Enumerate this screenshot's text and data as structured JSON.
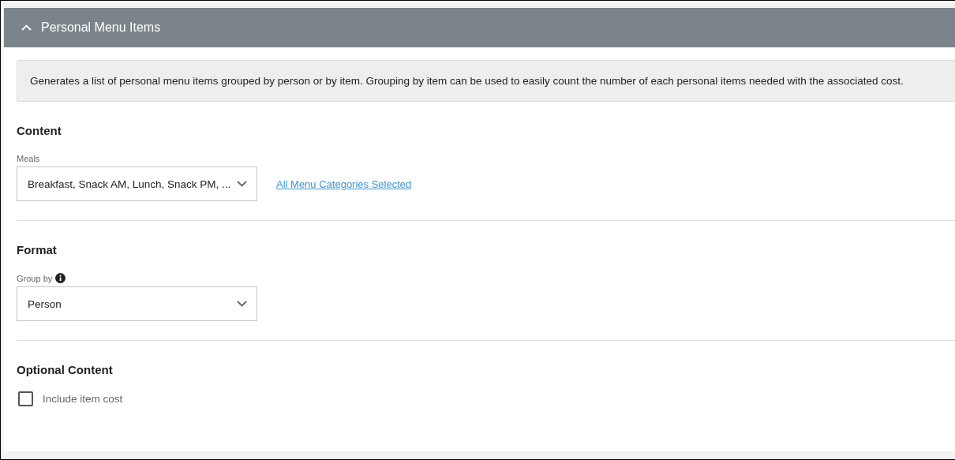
{
  "panel": {
    "title": "Personal Menu Items",
    "expanded": true
  },
  "description": "Generates a list of personal menu items grouped by person or by item. Grouping by item can be used to easily count the number of each personal items needed with the associated cost.",
  "sections": [
    {
      "heading": "Content",
      "fields": [
        {
          "kind": "select",
          "label": "Meals",
          "value": "Breakfast, Snack AM, Lunch, Snack PM, ...",
          "info": false,
          "link": "All Menu Categories Selected"
        }
      ]
    },
    {
      "heading": "Format",
      "fields": [
        {
          "kind": "select",
          "label": "Group by",
          "value": "Person",
          "info": true
        }
      ]
    },
    {
      "heading": "Optional Content",
      "fields": [
        {
          "kind": "checkbox",
          "label": "Include item cost",
          "checked": false
        }
      ]
    }
  ]
}
